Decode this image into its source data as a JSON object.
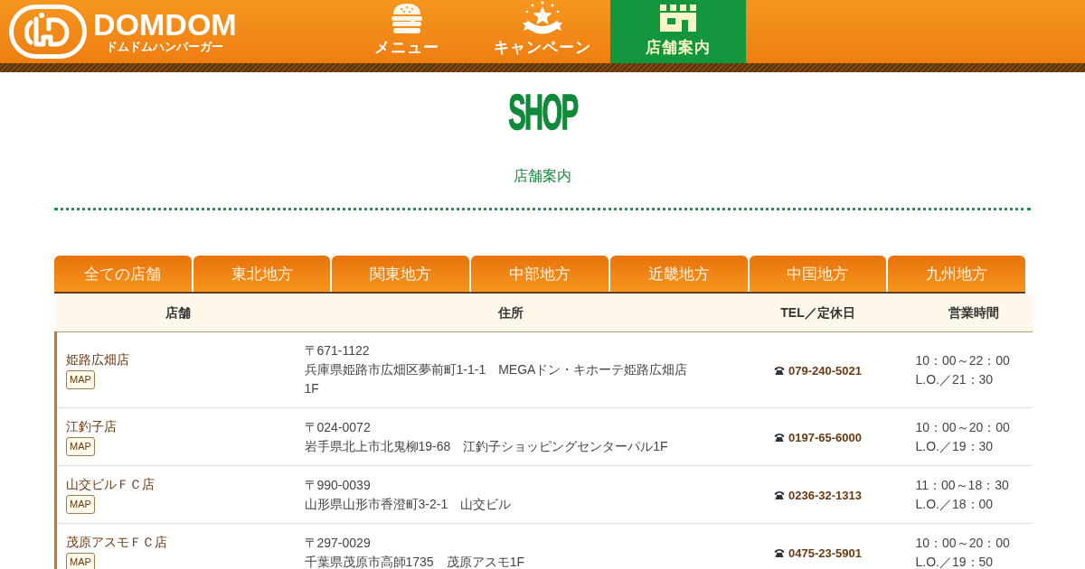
{
  "header": {
    "brand": {
      "wordmark": "DOMDOM",
      "tagline": "ドムドムハンバーガー"
    },
    "nav": [
      {
        "kind": "menu",
        "label": "メニュー",
        "selected": false
      },
      {
        "kind": "campaign",
        "label": "キャンペーン",
        "selected": false
      },
      {
        "kind": "stores",
        "label": "店舗案内",
        "selected": true
      }
    ]
  },
  "page": {
    "title": "SHOP",
    "subtitle": "店舗案内"
  },
  "region_tabs": [
    {
      "label": "全ての店舗",
      "selected": false
    },
    {
      "label": "東北地方",
      "selected": false
    },
    {
      "label": "関東地方",
      "selected": false
    },
    {
      "label": "中部地方",
      "selected": false
    },
    {
      "label": "近畿地方",
      "selected": false
    },
    {
      "label": "中国地方",
      "selected": false
    },
    {
      "label": "九州地方",
      "selected": false
    }
  ],
  "store_table": {
    "columns": [
      "店舗",
      "住所",
      "TEL／定休日",
      "営業時間"
    ],
    "rows": [
      {
        "store": "姫路広畑店",
        "map_button": "MAP",
        "postal_code": "〒671-1122",
        "address": "兵庫県姫路市広畑区夢前町1-1-1　MEGAドン・キホーテ姫路広畑店1F",
        "tel": "079-240-5021",
        "hours": "10：00～22：00",
        "last_order": "L.O.／21：30"
      },
      {
        "store": "江釣子店",
        "map_button": "MAP",
        "postal_code": "〒024-0072",
        "address": "岩手県北上市北鬼柳19-68　江釣子ショッピングセンターパル1F",
        "tel": "0197-65-6000",
        "hours": "10：00～20：00",
        "last_order": "L.O.／19：30"
      },
      {
        "store": "山交ビルＦＣ店",
        "map_button": "MAP",
        "postal_code": "〒990-0039",
        "address": "山形県山形市香澄町3-2-1　山交ビル",
        "tel": "0236-32-1313",
        "hours": "11：00～18：30",
        "last_order": "L.O.／18：00"
      },
      {
        "store": "茂原アスモＦＣ店",
        "map_button": "MAP",
        "postal_code": "〒297-0029",
        "address": "千葉県茂原市高師1735　茂原アスモ1F",
        "tel": "0475-23-5901",
        "hours": "10：00～20：00",
        "last_order": "L.O.／19：50"
      }
    ]
  }
}
